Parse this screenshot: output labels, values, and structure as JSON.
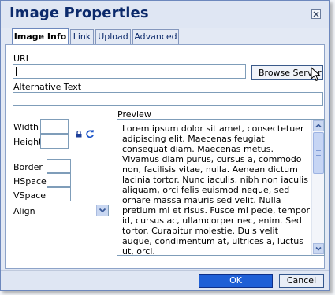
{
  "dialog": {
    "title": "Image Properties",
    "close_icon": "close-icon"
  },
  "tabs": [
    {
      "label": "Image Info",
      "active": true
    },
    {
      "label": "Link",
      "active": false
    },
    {
      "label": "Upload",
      "active": false
    },
    {
      "label": "Advanced",
      "active": false
    }
  ],
  "url": {
    "label": "URL",
    "value": ""
  },
  "browse_button": {
    "label": "Browse Server"
  },
  "alt": {
    "label": "Alternative Text",
    "value": ""
  },
  "dimensions": {
    "width_label": "Width",
    "height_label": "Height",
    "width_value": "",
    "height_value": "",
    "lock_icon": "lock-icon",
    "reset_icon": "refresh-icon"
  },
  "spacing": {
    "border_label": "Border",
    "hspace_label": "HSpace",
    "vspace_label": "VSpace",
    "align_label": "Align",
    "border_value": "",
    "hspace_value": "",
    "vspace_value": "",
    "align_value": ""
  },
  "preview": {
    "label": "Preview",
    "text": "Lorem ipsum dolor sit amet, consectetuer adipiscing elit. Maecenas feugiat consequat diam. Maecenas metus. Vivamus diam purus, cursus a, commodo non, facilisis vitae, nulla. Aenean dictum lacinia tortor. Nunc iaculis, nibh non iaculis aliquam, orci felis euismod neque, sed ornare massa mauris sed velit. Nulla pretium mi et risus. Fusce mi pede, tempor id, cursus ac, ullamcorper nec, enim. Sed tortor. Curabitur molestie. Duis velit augue, condimentum at, ultrices a, luctus ut, orci."
  },
  "footer": {
    "ok_label": "OK",
    "cancel_label": "Cancel"
  },
  "colors": {
    "title": "#0c2a6b",
    "accent": "#1e5fd6",
    "border": "#7f9db9",
    "background": "#e3e9f4"
  }
}
